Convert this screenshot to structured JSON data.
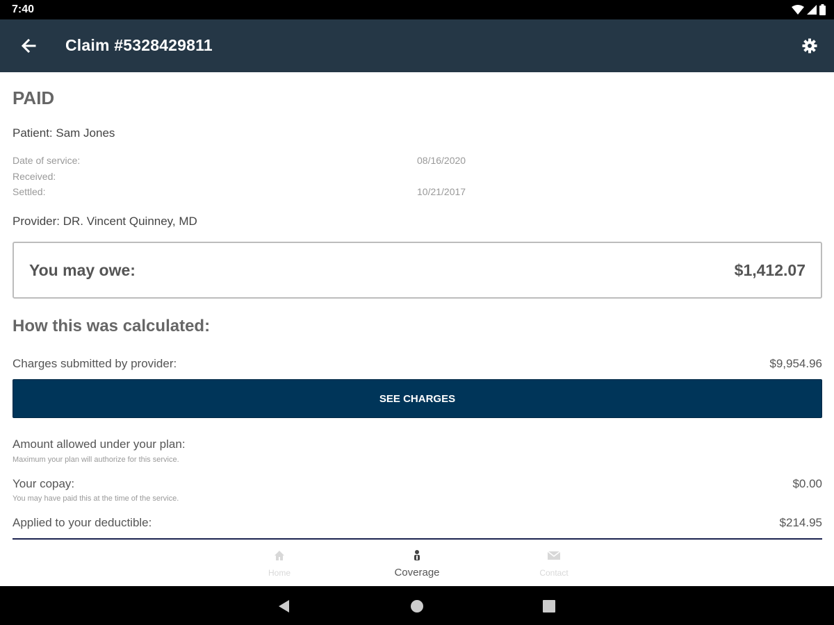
{
  "status_bar": {
    "time": "7:40"
  },
  "app_bar": {
    "title": "Claim #5328429811"
  },
  "claim": {
    "status": "PAID",
    "patient": "Patient: Sam Jones",
    "dates": [
      {
        "label": "Date of service:",
        "value": "08/16/2020"
      },
      {
        "label": "Received:",
        "value": ""
      },
      {
        "label": "Settled:",
        "value": "10/21/2017"
      }
    ],
    "provider": "Provider: DR. Vincent Quinney, MD"
  },
  "owe": {
    "label": "You may owe:",
    "value": "$1,412.07"
  },
  "calculation": {
    "heading": "How this was calculated:",
    "charges": {
      "label": "Charges submitted by provider:",
      "value": "$9,954.96"
    },
    "see_charges_label": "SEE CHARGES",
    "allowed": {
      "label": "Amount allowed under your plan:",
      "sub": "Maximum your plan will authorize for this service.",
      "value": ""
    },
    "copay": {
      "label": "Your copay:",
      "sub": "You may have paid this at the time of the service.",
      "value": "$0.00"
    },
    "deductible": {
      "label": "Applied to your deductible:",
      "value": "$214.95"
    }
  },
  "bottom_nav": {
    "items": [
      {
        "label": "Home",
        "icon": "home-icon",
        "active": false
      },
      {
        "label": "Coverage",
        "icon": "coverage-icon",
        "active": true
      },
      {
        "label": "Contact",
        "icon": "mail-icon",
        "active": false
      }
    ]
  },
  "colors": {
    "app_bar": "#253746",
    "button": "#003559",
    "divider": "#1c2350"
  }
}
